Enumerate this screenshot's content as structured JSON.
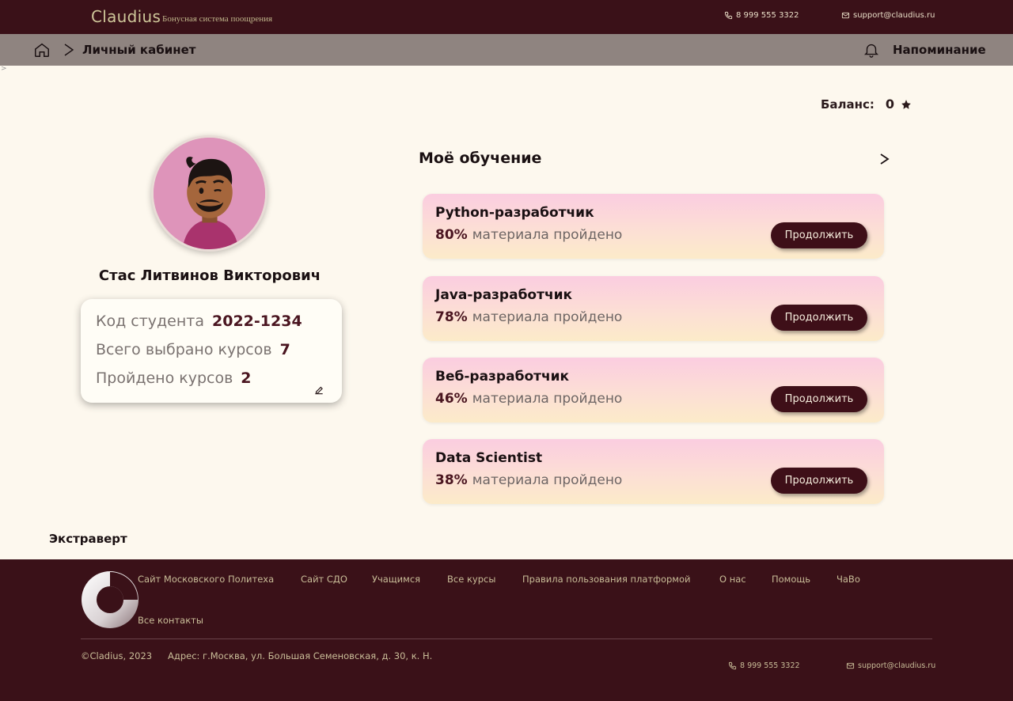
{
  "header": {
    "brand": "Claudius",
    "subtitle": "Бонусная система поощрения",
    "phone": "8 999 555 3322",
    "email": "support@claudius.ru"
  },
  "breadcrumb": {
    "current": "Личный кабинет",
    "reminder_label": "Напоминание"
  },
  "stray_char": ">",
  "balance": {
    "label": "Баланс:",
    "value": "0"
  },
  "profile": {
    "full_name": "Стас Литвинов Викторович",
    "student_code_label": "Код студента",
    "student_code": "2022-1234",
    "total_courses_label": "Всего выбрано курсов",
    "total_courses": "7",
    "completed_label": "Пройдено курсов",
    "completed": "2",
    "personality": "Экстраверт"
  },
  "learning": {
    "title": "Моё обучение",
    "arrow": ">",
    "progress_suffix": "материала пройдено",
    "continue_label": "Продолжить",
    "courses": [
      {
        "name": "Python-разработчик",
        "percent": "80%"
      },
      {
        "name": "Java-разработчик",
        "percent": "78%"
      },
      {
        "name": "Веб-разработчик",
        "percent": "46%"
      },
      {
        "name": "Data Scientist",
        "percent": "38%"
      }
    ]
  },
  "footer": {
    "links": [
      "Сайт Московского Политеха",
      "Сайт СДО",
      "Учащимся",
      "Все курсы",
      "Правила пользования платформой",
      "О нас",
      "Помощь",
      "ЧаВо",
      "Все контакты"
    ],
    "copyright": "©Cladius, 2023",
    "address": "Адрес: г.Москва, ул. Большая Семеновская, д. 30, к. Н.",
    "phone": "8 999 555 3322",
    "email": "support@claudius.ru"
  },
  "colors": {
    "header_bg": "#3a1118",
    "crumb_bg": "#8f8480",
    "page_bg": "#fdf8ee",
    "accent": "#4a1520",
    "button_bg": "#3e0f18"
  },
  "icons": [
    "phone-icon",
    "mail-icon",
    "home-icon",
    "chevron-right-icon",
    "bell-icon",
    "star-icon",
    "edit-icon",
    "logo-ring-icon"
  ]
}
